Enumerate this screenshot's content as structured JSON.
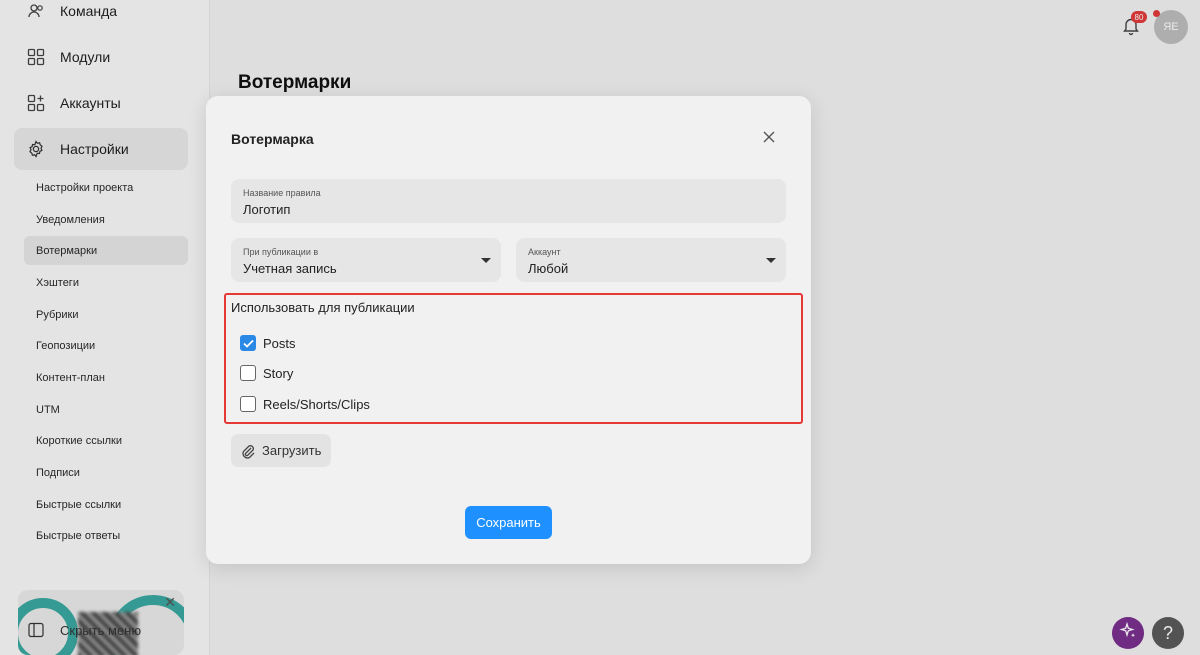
{
  "sidebar": {
    "nav": [
      {
        "label": "Команда",
        "icon": "users-icon"
      },
      {
        "label": "Модули",
        "icon": "modules-icon"
      },
      {
        "label": "Аккаунты",
        "icon": "accounts-icon"
      },
      {
        "label": "Настройки",
        "icon": "gear-icon"
      }
    ],
    "sub": [
      "Настройки проекта",
      "Уведомления",
      "Вотермарки",
      "Хэштеги",
      "Рубрики",
      "Геопозиции",
      "Контент-план",
      "UTM",
      "Короткие ссылки",
      "Подписи",
      "Быстрые ссылки",
      "Быстрые ответы"
    ],
    "collapse_label": "Скрыть меню"
  },
  "header": {
    "page_title": "Вотермарки",
    "notifications_count": "80",
    "avatar_initials": "ЯЕ"
  },
  "modal": {
    "title": "Вотермарка",
    "rule_name": {
      "label": "Название правила",
      "value": "Логотип"
    },
    "publish_in": {
      "label": "При публикации в",
      "value": "Учетная запись"
    },
    "account": {
      "label": "Аккаунт",
      "value": "Любой"
    },
    "use_for": {
      "label": "Использовать для публикации",
      "options": [
        {
          "label": "Posts",
          "checked": true
        },
        {
          "label": "Story",
          "checked": false
        },
        {
          "label": "Reels/Shorts/Clips",
          "checked": false
        }
      ]
    },
    "upload_label": "Загрузить",
    "save_label": "Сохранить"
  },
  "colors": {
    "accent": "#1e90ff",
    "highlight_border": "#e53935",
    "badge": "#e23b3b"
  }
}
